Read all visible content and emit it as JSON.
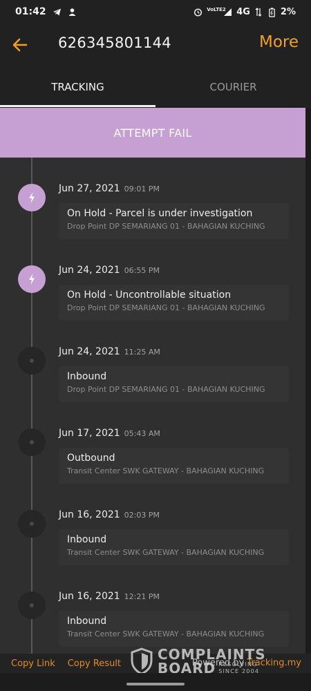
{
  "status_bar": {
    "time": "01:42",
    "network": "4G",
    "battery": "2%",
    "lte_label": "VoLTE2"
  },
  "header": {
    "title": "626345801144",
    "more_label": "More"
  },
  "tabs": [
    {
      "label": "TRACKING",
      "active": true
    },
    {
      "label": "COURIER",
      "active": false
    }
  ],
  "status_banner": {
    "label": "ATTEMPT FAIL",
    "color": "#c7a0d3"
  },
  "events": [
    {
      "date": "Jun 27, 2021",
      "time": "09:01 PM",
      "status": "On Hold - Parcel is under investigation",
      "location": "Drop Point DP SEMARIANG 01 - BAHAGIAN KUCHING",
      "highlight": true
    },
    {
      "date": "Jun 24, 2021",
      "time": "06:55 PM",
      "status": "On Hold - Uncontrollable situation",
      "location": "Drop Point DP SEMARIANG 01 - BAHAGIAN KUCHING",
      "highlight": true
    },
    {
      "date": "Jun 24, 2021",
      "time": "11:25 AM",
      "status": "Inbound",
      "location": "Drop Point DP SEMARIANG 01 - BAHAGIAN KUCHING",
      "highlight": false
    },
    {
      "date": "Jun 17, 2021",
      "time": "05:43 AM",
      "status": "Outbound",
      "location": "Transit Center SWK GATEWAY - BAHAGIAN KUCHING",
      "highlight": false
    },
    {
      "date": "Jun 16, 2021",
      "time": "02:03 PM",
      "status": "Inbound",
      "location": "Transit Center SWK GATEWAY - BAHAGIAN KUCHING",
      "highlight": false
    },
    {
      "date": "Jun 16, 2021",
      "time": "12:21 PM",
      "status": "Inbound",
      "location": "Transit Center SWK GATEWAY - BAHAGIAN KUCHING",
      "highlight": false
    }
  ],
  "bottom_bar": {
    "copy_link": "Copy Link",
    "copy_result": "Copy Result",
    "powered_prefix": "Powered by",
    "powered_brand": "Tracking.my"
  },
  "watermark": {
    "line1": "COMPLAINTS",
    "line2": "BOARD",
    "tag1": "RESOLVING",
    "tag2": "SINCE 2004"
  },
  "colors": {
    "accent": "#f0a02a",
    "link": "#e58a22",
    "event_highlight": "#c7a0d3"
  }
}
